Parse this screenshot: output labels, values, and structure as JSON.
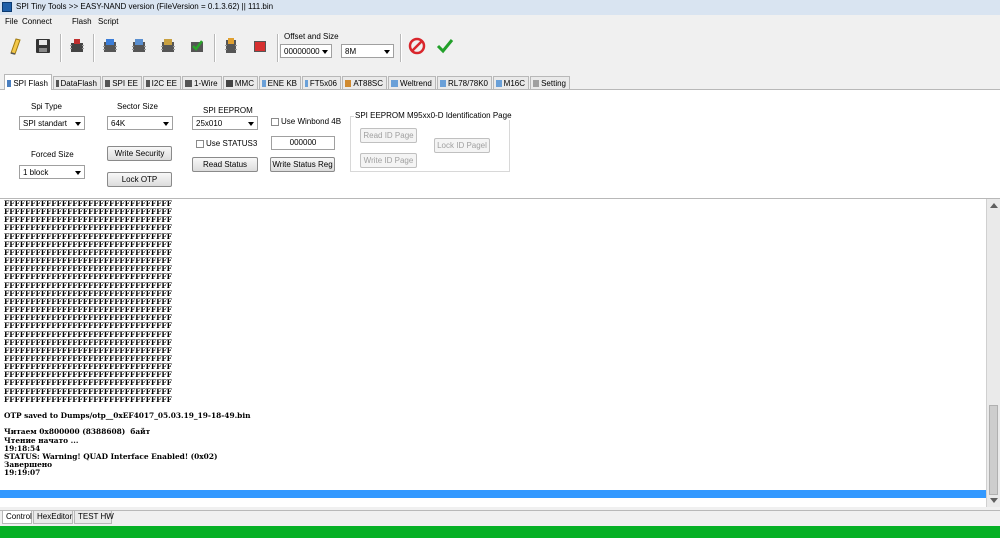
{
  "window": {
    "title": "SPI Tiny Tools >> EASY-NAND version (FileVersion = 0.1.3.62) || 111.bin"
  },
  "menu": [
    "File",
    "Connect",
    "Flash",
    "Script"
  ],
  "toolbar": {
    "icons": [
      "open-icon",
      "save-icon",
      "chip-red-icon",
      "chip-read-icon",
      "chip-verify-icon",
      "chip-erase-icon",
      "chip-check-icon",
      "chip-write-icon",
      "chip-stop-icon",
      "cancel-icon",
      "ok-icon"
    ],
    "offset_size_label": "Offset and Size",
    "offset_value": "00000000",
    "size_value": "8M"
  },
  "tabs": [
    "SPI Flash",
    "DataFlash",
    "SPI EE",
    "I2C EE",
    "1-Wire",
    "MMC",
    "ENE KB",
    "FT5x06",
    "AT88SC",
    "Weltrend",
    "RL78/78K0",
    "M16C",
    "Setting"
  ],
  "active_tab": "SPI Flash",
  "panel": {
    "spi_type_label": "Spi Type",
    "spi_type_value": "SPI standart",
    "sector_size_label": "Sector Size",
    "sector_size_value": "64K",
    "spi_eeprom_label": "SPI EEPROM",
    "spi_eeprom_value": "25x010",
    "use_winbond_label": "Use Winbond 4B",
    "use_winbond_checked": false,
    "use_status3_label": "Use STATUS3",
    "use_status3_checked": false,
    "status_value": "000000",
    "forced_size_label": "Forced Size",
    "forced_size_value": "1 block",
    "write_security_label": "Write Security",
    "lock_otp_label": "Lock OTP",
    "read_status_label": "Read Status",
    "write_status_reg_label": "Write Status Reg",
    "id_group_label": "SPI EEPROM M95xx0-D Identification Page",
    "read_id_page_label": "Read ID Page",
    "write_id_page_label": "Write ID Page",
    "lock_id_page_label": "Lock ID Pagel"
  },
  "log": {
    "text": "FFFFFFFFFFFFFFFFFFFFFFFFFFFFFFFF\nFFFFFFFFFFFFFFFFFFFFFFFFFFFFFFFF\nFFFFFFFFFFFFFFFFFFFFFFFFFFFFFFFF\nFFFFFFFFFFFFFFFFFFFFFFFFFFFFFFFF\nFFFFFFFFFFFFFFFFFFFFFFFFFFFFFFFF\nFFFFFFFFFFFFFFFFFFFFFFFFFFFFFFFF\nFFFFFFFFFFFFFFFFFFFFFFFFFFFFFFFF\nFFFFFFFFFFFFFFFFFFFFFFFFFFFFFFFF\nFFFFFFFFFFFFFFFFFFFFFFFFFFFFFFFF\nFFFFFFFFFFFFFFFFFFFFFFFFFFFFFFFF\nFFFFFFFFFFFFFFFFFFFFFFFFFFFFFFFF\nFFFFFFFFFFFFFFFFFFFFFFFFFFFFFFFF\nFFFFFFFFFFFFFFFFFFFFFFFFFFFFFFFF\nFFFFFFFFFFFFFFFFFFFFFFFFFFFFFFFF\nFFFFFFFFFFFFFFFFFFFFFFFFFFFFFFFF\nFFFFFFFFFFFFFFFFFFFFFFFFFFFFFFFF\nFFFFFFFFFFFFFFFFFFFFFFFFFFFFFFFF\nFFFFFFFFFFFFFFFFFFFFFFFFFFFFFFFF\nFFFFFFFFFFFFFFFFFFFFFFFFFFFFFFFF\nFFFFFFFFFFFFFFFFFFFFFFFFFFFFFFFF\nFFFFFFFFFFFFFFFFFFFFFFFFFFFFFFFF\nFFFFFFFFFFFFFFFFFFFFFFFFFFFFFFFF\nFFFFFFFFFFFFFFFFFFFFFFFFFFFFFFFF\nFFFFFFFFFFFFFFFFFFFFFFFFFFFFFFFF\nFFFFFFFFFFFFFFFFFFFFFFFFFFFFFFFF\n\nOTP saved to Dumps/otp__0xEF4017_05.03.19_19-18-49.bin\n\nЧитаем 0x800000 (8388608)  байт\nЧтение начато ...\n19:18:54\nSTATUS: Warning! QUAD Interface Enabled! (0x02)\nЗавершено\n19:19:07"
  },
  "bottom_tabs": [
    "Control",
    "HexEditor",
    "TEST HW"
  ],
  "active_bottom_tab": "Control",
  "progress_fraction": 1.0,
  "colors": {
    "progress": "#06b025",
    "highlight": "#3399ff",
    "cancel": "#d9262c",
    "ok": "#22a02a"
  }
}
